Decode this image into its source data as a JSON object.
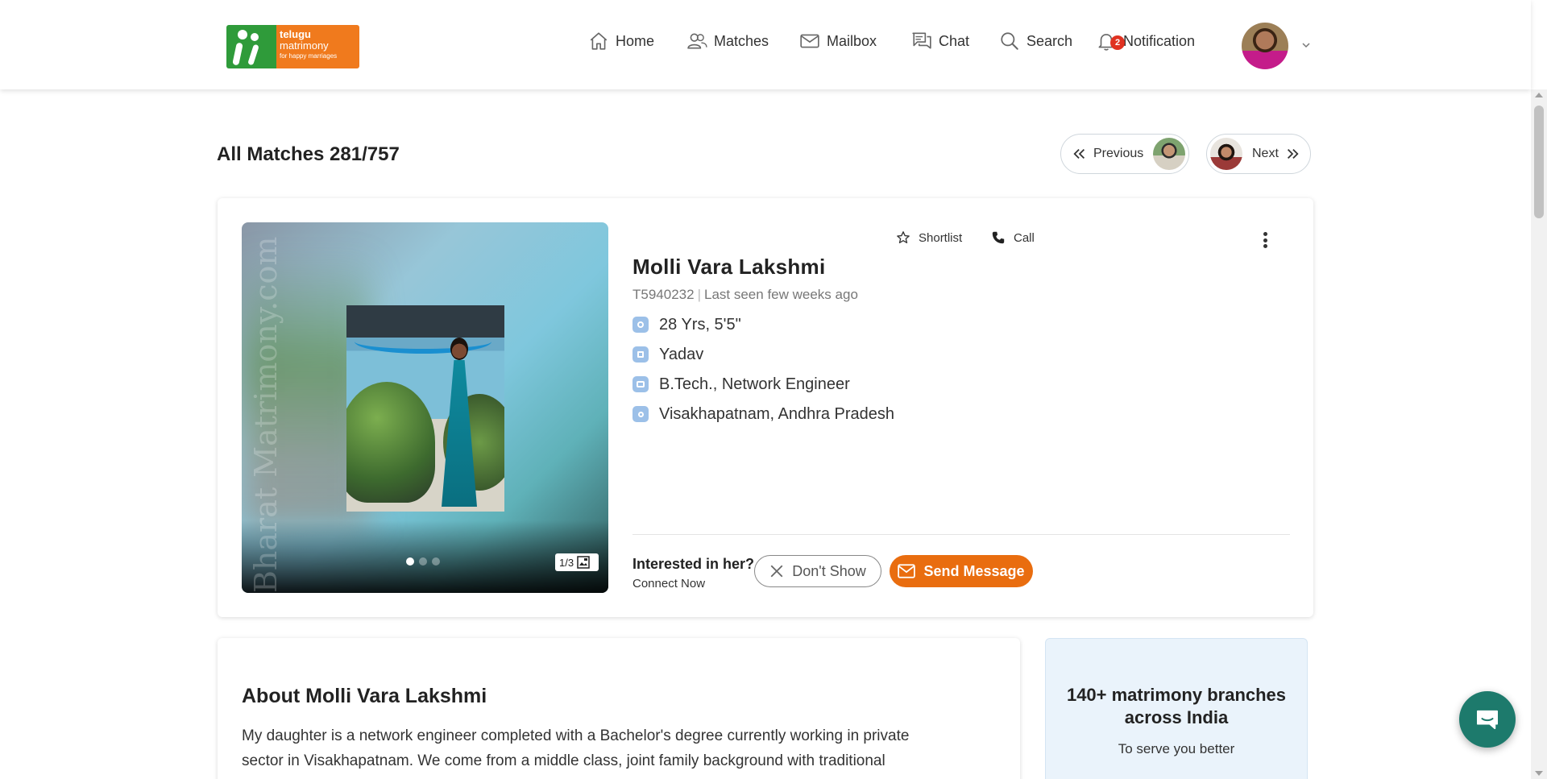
{
  "logo": {
    "line1": "telugu",
    "line2": "matrimony",
    "tagline": "for happy marriages"
  },
  "nav": {
    "home": "Home",
    "matches": "Matches",
    "mailbox": "Mailbox",
    "chat": "Chat",
    "search": "Search",
    "notification": "Notification",
    "notification_count": "2"
  },
  "page": {
    "title": "All Matches 281/757"
  },
  "pager": {
    "previous": "Previous",
    "next": "Next"
  },
  "profile": {
    "name": "Molli Vara Lakshmi",
    "id": "T5940232",
    "last_seen": "Last seen few weeks ago",
    "age_height": "28 Yrs, 5'5\"",
    "caste": "Yadav",
    "education_job": "B.Tech., Network Engineer",
    "location": "Visakhapatnam, Andhra Pradesh",
    "watermark": "Bharat Matrimony.com",
    "photo_counter": "1/3",
    "photo_count": 3,
    "photo_active_index": 0
  },
  "actions": {
    "shortlist": "Shortlist",
    "call": "Call",
    "interest_question": "Interested in her?",
    "connect_now": "Connect Now",
    "dont_show": "Don't Show",
    "send_message": "Send Message"
  },
  "about": {
    "title": "About Molli Vara Lakshmi",
    "text": "My daughter is a network engineer completed with a Bachelor's degree currently working in private sector in Visakhapatnam. We come from a middle class, joint family background with traditional values."
  },
  "branches": {
    "title": "140+ matrimony branches across India",
    "subtitle": "To serve you better"
  },
  "colors": {
    "accent_orange": "#e96d0f",
    "brand_green": "#2f9b3a",
    "badge_red": "#e03221",
    "chat_fab": "#1d7a6c",
    "fact_icon_blue": "#9cc0e8"
  },
  "icons": [
    "home-icon",
    "matches-icon",
    "mailbox-icon",
    "chat-icon",
    "search-icon",
    "bell-icon",
    "chevron-down-icon",
    "double-chevron-left-icon",
    "double-chevron-right-icon",
    "star-icon",
    "phone-icon",
    "more-vertical-icon",
    "close-icon",
    "mail-icon",
    "gallery-icon",
    "chat-bubble-icon"
  ]
}
